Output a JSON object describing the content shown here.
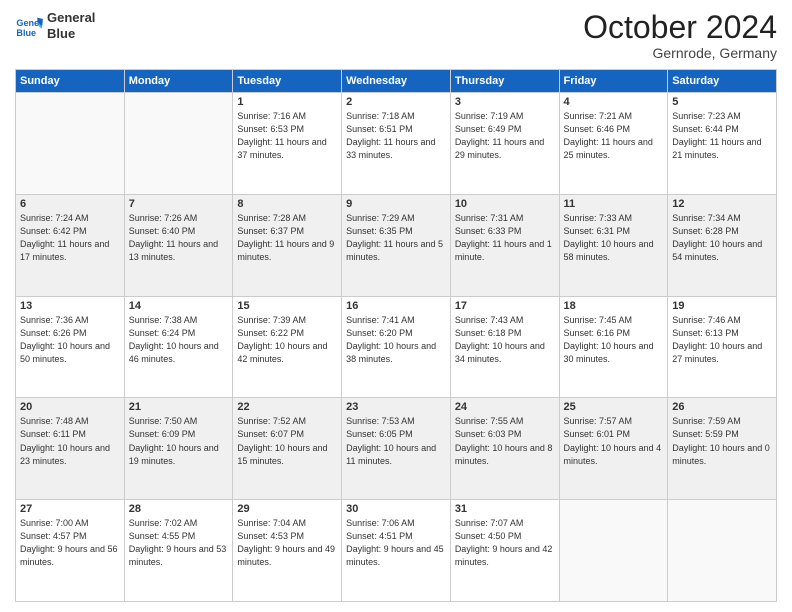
{
  "header": {
    "logo_line1": "General",
    "logo_line2": "Blue",
    "month_title": "October 2024",
    "location": "Gernrode, Germany"
  },
  "days_of_week": [
    "Sunday",
    "Monday",
    "Tuesday",
    "Wednesday",
    "Thursday",
    "Friday",
    "Saturday"
  ],
  "weeks": [
    {
      "days": [
        {
          "num": "",
          "info": ""
        },
        {
          "num": "",
          "info": ""
        },
        {
          "num": "1",
          "info": "Sunrise: 7:16 AM\nSunset: 6:53 PM\nDaylight: 11 hours and 37 minutes."
        },
        {
          "num": "2",
          "info": "Sunrise: 7:18 AM\nSunset: 6:51 PM\nDaylight: 11 hours and 33 minutes."
        },
        {
          "num": "3",
          "info": "Sunrise: 7:19 AM\nSunset: 6:49 PM\nDaylight: 11 hours and 29 minutes."
        },
        {
          "num": "4",
          "info": "Sunrise: 7:21 AM\nSunset: 6:46 PM\nDaylight: 11 hours and 25 minutes."
        },
        {
          "num": "5",
          "info": "Sunrise: 7:23 AM\nSunset: 6:44 PM\nDaylight: 11 hours and 21 minutes."
        }
      ]
    },
    {
      "days": [
        {
          "num": "6",
          "info": "Sunrise: 7:24 AM\nSunset: 6:42 PM\nDaylight: 11 hours and 17 minutes."
        },
        {
          "num": "7",
          "info": "Sunrise: 7:26 AM\nSunset: 6:40 PM\nDaylight: 11 hours and 13 minutes."
        },
        {
          "num": "8",
          "info": "Sunrise: 7:28 AM\nSunset: 6:37 PM\nDaylight: 11 hours and 9 minutes."
        },
        {
          "num": "9",
          "info": "Sunrise: 7:29 AM\nSunset: 6:35 PM\nDaylight: 11 hours and 5 minutes."
        },
        {
          "num": "10",
          "info": "Sunrise: 7:31 AM\nSunset: 6:33 PM\nDaylight: 11 hours and 1 minute."
        },
        {
          "num": "11",
          "info": "Sunrise: 7:33 AM\nSunset: 6:31 PM\nDaylight: 10 hours and 58 minutes."
        },
        {
          "num": "12",
          "info": "Sunrise: 7:34 AM\nSunset: 6:28 PM\nDaylight: 10 hours and 54 minutes."
        }
      ]
    },
    {
      "days": [
        {
          "num": "13",
          "info": "Sunrise: 7:36 AM\nSunset: 6:26 PM\nDaylight: 10 hours and 50 minutes."
        },
        {
          "num": "14",
          "info": "Sunrise: 7:38 AM\nSunset: 6:24 PM\nDaylight: 10 hours and 46 minutes."
        },
        {
          "num": "15",
          "info": "Sunrise: 7:39 AM\nSunset: 6:22 PM\nDaylight: 10 hours and 42 minutes."
        },
        {
          "num": "16",
          "info": "Sunrise: 7:41 AM\nSunset: 6:20 PM\nDaylight: 10 hours and 38 minutes."
        },
        {
          "num": "17",
          "info": "Sunrise: 7:43 AM\nSunset: 6:18 PM\nDaylight: 10 hours and 34 minutes."
        },
        {
          "num": "18",
          "info": "Sunrise: 7:45 AM\nSunset: 6:16 PM\nDaylight: 10 hours and 30 minutes."
        },
        {
          "num": "19",
          "info": "Sunrise: 7:46 AM\nSunset: 6:13 PM\nDaylight: 10 hours and 27 minutes."
        }
      ]
    },
    {
      "days": [
        {
          "num": "20",
          "info": "Sunrise: 7:48 AM\nSunset: 6:11 PM\nDaylight: 10 hours and 23 minutes."
        },
        {
          "num": "21",
          "info": "Sunrise: 7:50 AM\nSunset: 6:09 PM\nDaylight: 10 hours and 19 minutes."
        },
        {
          "num": "22",
          "info": "Sunrise: 7:52 AM\nSunset: 6:07 PM\nDaylight: 10 hours and 15 minutes."
        },
        {
          "num": "23",
          "info": "Sunrise: 7:53 AM\nSunset: 6:05 PM\nDaylight: 10 hours and 11 minutes."
        },
        {
          "num": "24",
          "info": "Sunrise: 7:55 AM\nSunset: 6:03 PM\nDaylight: 10 hours and 8 minutes."
        },
        {
          "num": "25",
          "info": "Sunrise: 7:57 AM\nSunset: 6:01 PM\nDaylight: 10 hours and 4 minutes."
        },
        {
          "num": "26",
          "info": "Sunrise: 7:59 AM\nSunset: 5:59 PM\nDaylight: 10 hours and 0 minutes."
        }
      ]
    },
    {
      "days": [
        {
          "num": "27",
          "info": "Sunrise: 7:00 AM\nSunset: 4:57 PM\nDaylight: 9 hours and 56 minutes."
        },
        {
          "num": "28",
          "info": "Sunrise: 7:02 AM\nSunset: 4:55 PM\nDaylight: 9 hours and 53 minutes."
        },
        {
          "num": "29",
          "info": "Sunrise: 7:04 AM\nSunset: 4:53 PM\nDaylight: 9 hours and 49 minutes."
        },
        {
          "num": "30",
          "info": "Sunrise: 7:06 AM\nSunset: 4:51 PM\nDaylight: 9 hours and 45 minutes."
        },
        {
          "num": "31",
          "info": "Sunrise: 7:07 AM\nSunset: 4:50 PM\nDaylight: 9 hours and 42 minutes."
        },
        {
          "num": "",
          "info": ""
        },
        {
          "num": "",
          "info": ""
        }
      ]
    }
  ]
}
